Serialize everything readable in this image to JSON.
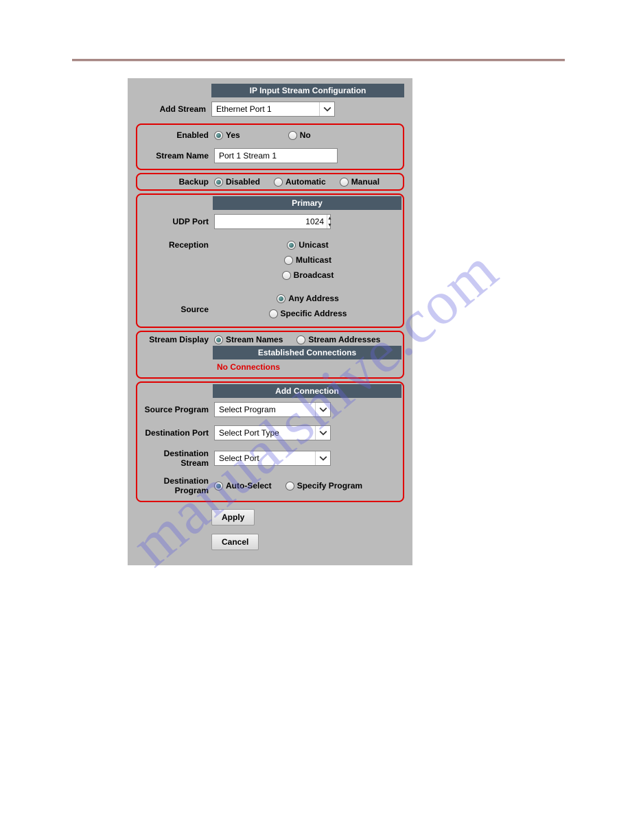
{
  "headers": {
    "main": "IP Input Stream Configuration",
    "primary": "Primary",
    "established": "Established Connections",
    "addconn": "Add Connection"
  },
  "labels": {
    "addStream": "Add Stream",
    "enabled": "Enabled",
    "streamName": "Stream Name",
    "backup": "Backup",
    "udpPort": "UDP Port",
    "reception": "Reception",
    "source": "Source",
    "streamDisplay": "Stream Display",
    "sourceProgram": "Source Program",
    "destPort": "Destination Port",
    "destStream": "Destination Stream",
    "destProgram": "Destination Program"
  },
  "values": {
    "addStream": "Ethernet Port 1",
    "streamName": "Port 1 Stream 1",
    "udpPort": "1024",
    "sourceProgram": "Select Program",
    "destPort": "Select Port Type",
    "destStream": "Select Port"
  },
  "radios": {
    "enabled": {
      "yes": "Yes",
      "no": "No"
    },
    "backup": {
      "disabled": "Disabled",
      "automatic": "Automatic",
      "manual": "Manual"
    },
    "reception": {
      "unicast": "Unicast",
      "multicast": "Multicast",
      "broadcast": "Broadcast"
    },
    "sourceAddr": {
      "any": "Any Address",
      "specific": "Specific Address"
    },
    "streamDisplay": {
      "names": "Stream Names",
      "addresses": "Stream Addresses"
    },
    "destProgram": {
      "auto": "Auto-Select",
      "specify": "Specify Program"
    }
  },
  "messages": {
    "noConn": "No Connections"
  },
  "buttons": {
    "apply": "Apply",
    "cancel": "Cancel"
  },
  "watermark": "manualshive.com"
}
